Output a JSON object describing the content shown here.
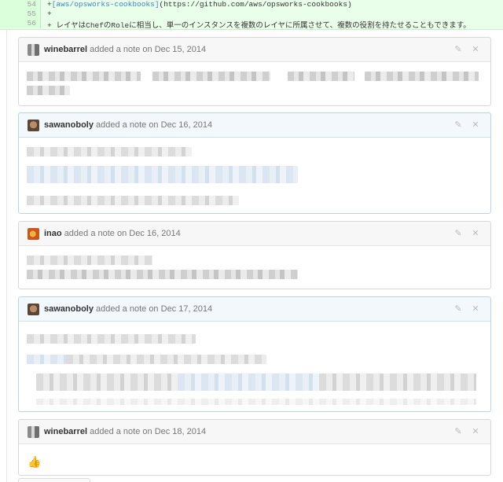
{
  "diff": {
    "lines": [
      {
        "num": "54",
        "prefix": "+",
        "link": "[aws/opsworks-cookbooks]",
        "rest": "(https://github.com/aws/opsworks-cookbooks)"
      },
      {
        "num": "55",
        "prefix": "+",
        "link": "",
        "rest": ""
      },
      {
        "num": "56",
        "prefix": "+",
        "link": "",
        "rest": "  レイヤはChefのRoleに相当し、単一のインスタンスを複数のレイヤに所属させて、複数の役割を持たせることもできます。"
      }
    ]
  },
  "notes": [
    {
      "author": "winebarrel",
      "action": "added a note on",
      "date": "Dec 15, 2014"
    },
    {
      "author": "sawanoboly",
      "action": "added a note on",
      "date": "Dec 16, 2014"
    },
    {
      "author": "inao",
      "action": "added a note on",
      "date": "Dec 16, 2014"
    },
    {
      "author": "sawanoboly",
      "action": "added a note on",
      "date": "Dec 17, 2014"
    },
    {
      "author": "winebarrel",
      "action": "added a note on",
      "date": "Dec 18, 2014",
      "body": "👍"
    }
  ],
  "icons": {
    "edit": "pencil-icon",
    "delete": "close-icon"
  }
}
